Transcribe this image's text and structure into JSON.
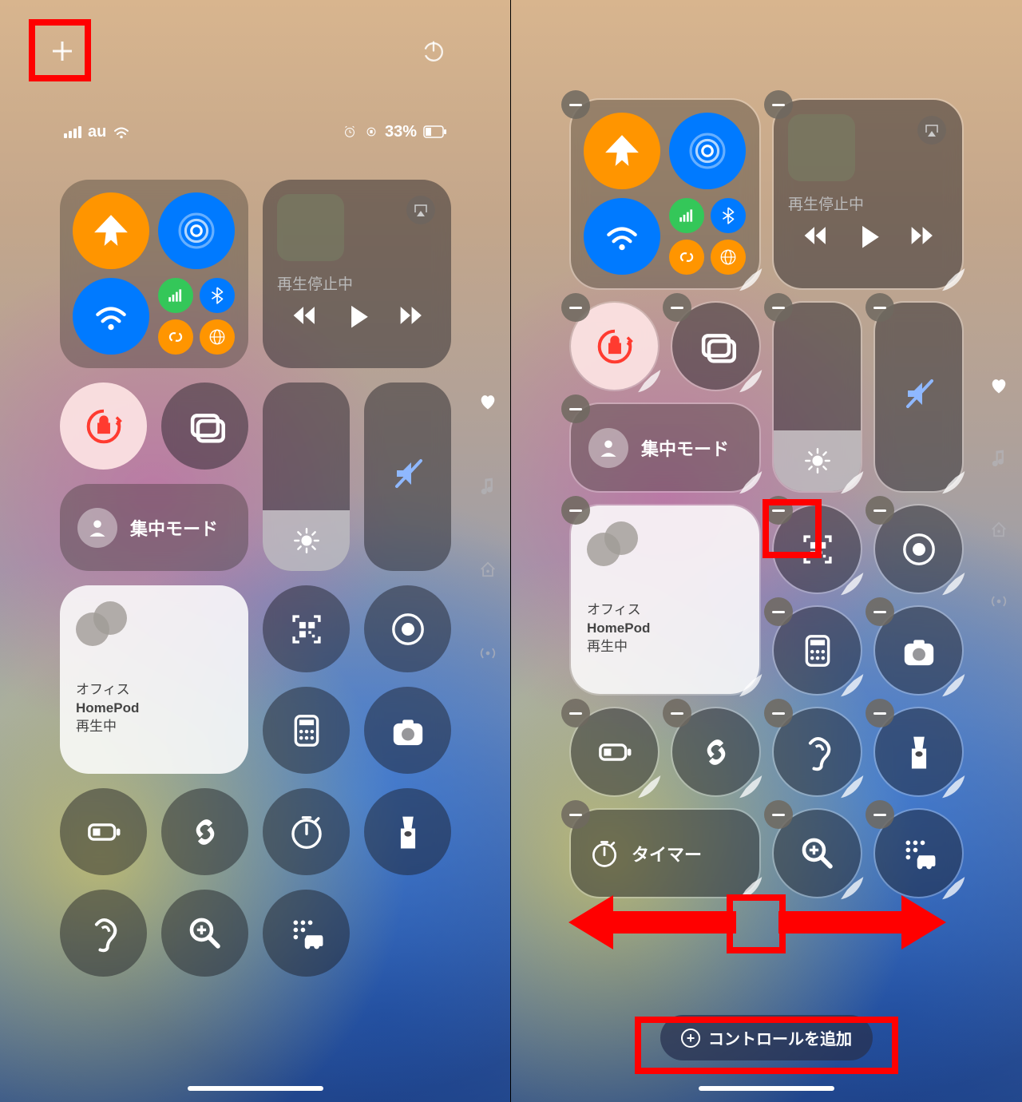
{
  "status": {
    "carrier": "au",
    "battery": "33%"
  },
  "nowplaying": {
    "status": "再生停止中"
  },
  "focus": {
    "label": "集中モード"
  },
  "homepod": {
    "room": "オフィス",
    "name": "HomePod",
    "state": "再生中"
  },
  "timer": {
    "label": "タイマー"
  },
  "add_controls": "コントロールを追加",
  "icons": {
    "plus": "plus-icon",
    "power": "power-icon",
    "airplane": "airplane-icon",
    "airdrop": "airdrop-icon",
    "wifi": "wifi-icon",
    "cellular": "cellular-icon",
    "bluetooth": "bluetooth-icon",
    "hotspot": "hotspot-icon",
    "satellite": "satellite-icon",
    "airplay": "airplay-icon",
    "rewind": "rewind-icon",
    "play": "play-icon",
    "forward": "forward-icon",
    "rotation-lock": "rotation-lock-icon",
    "screen-mirror": "screen-mirror-icon",
    "brightness": "brightness-icon",
    "mute": "mute-icon",
    "heart": "heart-icon",
    "music-note": "music-note-icon",
    "home": "home-icon",
    "signal": "signal-icon",
    "person": "person-icon",
    "qr": "qr-icon",
    "record": "record-icon",
    "calculator": "calculator-icon",
    "camera": "camera-icon",
    "battery": "battery-icon",
    "shazam": "shazam-icon",
    "stopwatch": "stopwatch-icon",
    "flashlight": "flashlight-icon",
    "hearing": "hearing-icon",
    "magnifier": "magnifier-icon",
    "driving-assist": "driving-assist-icon",
    "remove": "remove-icon",
    "resize": "resize-icon"
  }
}
